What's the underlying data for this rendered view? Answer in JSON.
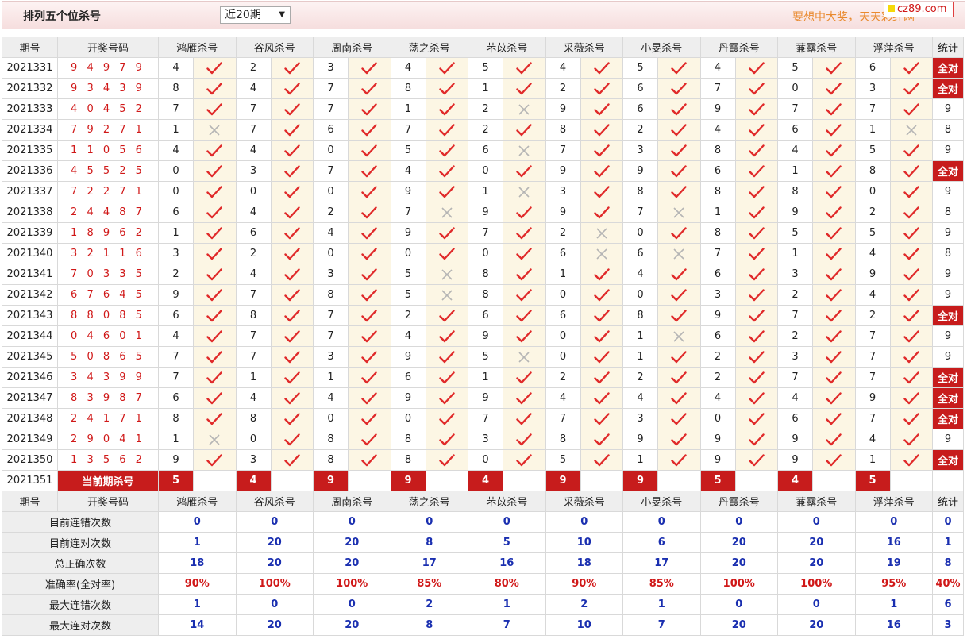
{
  "header": {
    "title": "排列五个位杀号",
    "range_select": "近20期",
    "marquee": "要想中大奖，天天彩经网",
    "logo": "cz89.com"
  },
  "columns": {
    "period": "期号",
    "draw": "开奖号码",
    "experts": [
      "鸿雁杀号",
      "谷风杀号",
      "周南杀号",
      "荡之杀号",
      "芣苡杀号",
      "采薇杀号",
      "小旻杀号",
      "丹霞杀号",
      "蒹露杀号",
      "浮萍杀号"
    ],
    "total": "统计"
  },
  "rows": [
    {
      "period": "2021331",
      "draw": "9 4 9 7 9",
      "kills": [
        4,
        2,
        3,
        4,
        5,
        4,
        5,
        4,
        5,
        6
      ],
      "hits": [
        1,
        1,
        1,
        1,
        1,
        1,
        1,
        1,
        1,
        1
      ],
      "total": "全对"
    },
    {
      "period": "2021332",
      "draw": "9 3 4 3 9",
      "kills": [
        8,
        4,
        7,
        8,
        1,
        2,
        6,
        7,
        0,
        3
      ],
      "hits": [
        1,
        1,
        1,
        1,
        1,
        1,
        1,
        1,
        1,
        1
      ],
      "total": "全对"
    },
    {
      "period": "2021333",
      "draw": "4 0 4 5 2",
      "kills": [
        7,
        7,
        7,
        1,
        2,
        9,
        6,
        9,
        7,
        7
      ],
      "hits": [
        1,
        1,
        1,
        1,
        0,
        1,
        1,
        1,
        1,
        1
      ],
      "total": "9"
    },
    {
      "period": "2021334",
      "draw": "7 9 2 7 1",
      "kills": [
        1,
        7,
        6,
        7,
        2,
        8,
        2,
        4,
        6,
        1
      ],
      "hits": [
        0,
        1,
        1,
        1,
        1,
        1,
        1,
        1,
        1,
        0
      ],
      "total": "8"
    },
    {
      "period": "2021335",
      "draw": "1 1 0 5 6",
      "kills": [
        4,
        4,
        0,
        5,
        6,
        7,
        3,
        8,
        4,
        5
      ],
      "hits": [
        1,
        1,
        1,
        1,
        0,
        1,
        1,
        1,
        1,
        1
      ],
      "total": "9"
    },
    {
      "period": "2021336",
      "draw": "4 5 5 2 5",
      "kills": [
        0,
        3,
        7,
        4,
        0,
        9,
        9,
        6,
        1,
        8
      ],
      "hits": [
        1,
        1,
        1,
        1,
        1,
        1,
        1,
        1,
        1,
        1
      ],
      "total": "全对"
    },
    {
      "period": "2021337",
      "draw": "7 2 2 7 1",
      "kills": [
        0,
        0,
        0,
        9,
        1,
        3,
        8,
        8,
        8,
        0
      ],
      "hits": [
        1,
        1,
        1,
        1,
        0,
        1,
        1,
        1,
        1,
        1
      ],
      "total": "9"
    },
    {
      "period": "2021338",
      "draw": "2 4 4 8 7",
      "kills": [
        6,
        4,
        2,
        7,
        9,
        9,
        7,
        1,
        9,
        2
      ],
      "hits": [
        1,
        1,
        1,
        0,
        1,
        1,
        0,
        1,
        1,
        1
      ],
      "total": "8"
    },
    {
      "period": "2021339",
      "draw": "1 8 9 6 2",
      "kills": [
        1,
        6,
        4,
        9,
        7,
        2,
        0,
        8,
        5,
        5
      ],
      "hits": [
        1,
        1,
        1,
        1,
        1,
        0,
        1,
        1,
        1,
        1
      ],
      "total": "9"
    },
    {
      "period": "2021340",
      "draw": "3 2 1 1 6",
      "kills": [
        3,
        2,
        0,
        0,
        0,
        6,
        6,
        7,
        1,
        4
      ],
      "hits": [
        1,
        1,
        1,
        1,
        1,
        0,
        0,
        1,
        1,
        1
      ],
      "total": "8"
    },
    {
      "period": "2021341",
      "draw": "7 0 3 3 5",
      "kills": [
        2,
        4,
        3,
        5,
        8,
        1,
        4,
        6,
        3,
        9
      ],
      "hits": [
        1,
        1,
        1,
        0,
        1,
        1,
        1,
        1,
        1,
        1
      ],
      "total": "9"
    },
    {
      "period": "2021342",
      "draw": "6 7 6 4 5",
      "kills": [
        9,
        7,
        8,
        5,
        8,
        0,
        0,
        3,
        2,
        4
      ],
      "hits": [
        1,
        1,
        1,
        0,
        1,
        1,
        1,
        1,
        1,
        1
      ],
      "total": "9"
    },
    {
      "period": "2021343",
      "draw": "8 8 0 8 5",
      "kills": [
        6,
        8,
        7,
        2,
        6,
        6,
        8,
        9,
        7,
        2
      ],
      "hits": [
        1,
        1,
        1,
        1,
        1,
        1,
        1,
        1,
        1,
        1
      ],
      "total": "全对"
    },
    {
      "period": "2021344",
      "draw": "0 4 6 0 1",
      "kills": [
        4,
        7,
        7,
        4,
        9,
        0,
        1,
        6,
        2,
        7
      ],
      "hits": [
        1,
        1,
        1,
        1,
        1,
        1,
        0,
        1,
        1,
        1
      ],
      "total": "9"
    },
    {
      "period": "2021345",
      "draw": "5 0 8 6 5",
      "kills": [
        7,
        7,
        3,
        9,
        5,
        0,
        1,
        2,
        3,
        7
      ],
      "hits": [
        1,
        1,
        1,
        1,
        0,
        1,
        1,
        1,
        1,
        1
      ],
      "total": "9"
    },
    {
      "period": "2021346",
      "draw": "3 4 3 9 9",
      "kills": [
        7,
        1,
        1,
        6,
        1,
        2,
        2,
        2,
        7,
        7
      ],
      "hits": [
        1,
        1,
        1,
        1,
        1,
        1,
        1,
        1,
        1,
        1
      ],
      "total": "全对"
    },
    {
      "period": "2021347",
      "draw": "8 3 9 8 7",
      "kills": [
        6,
        4,
        4,
        9,
        9,
        4,
        4,
        4,
        4,
        9
      ],
      "hits": [
        1,
        1,
        1,
        1,
        1,
        1,
        1,
        1,
        1,
        1
      ],
      "total": "全对"
    },
    {
      "period": "2021348",
      "draw": "2 4 1 7 1",
      "kills": [
        8,
        8,
        0,
        0,
        7,
        7,
        3,
        0,
        6,
        7
      ],
      "hits": [
        1,
        1,
        1,
        1,
        1,
        1,
        1,
        1,
        1,
        1
      ],
      "total": "全对"
    },
    {
      "period": "2021349",
      "draw": "2 9 0 4 1",
      "kills": [
        1,
        0,
        8,
        8,
        3,
        8,
        9,
        9,
        9,
        4
      ],
      "hits": [
        0,
        1,
        1,
        1,
        1,
        1,
        1,
        1,
        1,
        1
      ],
      "total": "9"
    },
    {
      "period": "2021350",
      "draw": "1 3 5 6 2",
      "kills": [
        9,
        3,
        8,
        8,
        0,
        5,
        1,
        9,
        9,
        1
      ],
      "hits": [
        1,
        1,
        1,
        1,
        1,
        1,
        1,
        1,
        1,
        1
      ],
      "total": "全对"
    }
  ],
  "current": {
    "period": "2021351",
    "label": "当前期杀号",
    "kills": [
      5,
      4,
      9,
      9,
      4,
      9,
      9,
      5,
      4,
      5
    ]
  },
  "stats": [
    {
      "label": "目前连错次数",
      "values": [
        "0",
        "0",
        "0",
        "0",
        "0",
        "0",
        "0",
        "0",
        "0",
        "0"
      ],
      "total": "0"
    },
    {
      "label": "目前连对次数",
      "values": [
        "1",
        "20",
        "20",
        "8",
        "5",
        "10",
        "6",
        "20",
        "20",
        "16"
      ],
      "total": "1"
    },
    {
      "label": "总正确次数",
      "values": [
        "18",
        "20",
        "20",
        "17",
        "16",
        "18",
        "17",
        "20",
        "20",
        "19"
      ],
      "total": "8"
    },
    {
      "label": "准确率(全对率)",
      "values": [
        "90%",
        "100%",
        "100%",
        "85%",
        "80%",
        "90%",
        "85%",
        "100%",
        "100%",
        "95%"
      ],
      "total": "40%",
      "rate": true
    },
    {
      "label": "最大连错次数",
      "values": [
        "1",
        "0",
        "0",
        "2",
        "1",
        "2",
        "1",
        "0",
        "0",
        "1"
      ],
      "total": "6"
    },
    {
      "label": "最大连对次数",
      "values": [
        "14",
        "20",
        "20",
        "8",
        "7",
        "10",
        "7",
        "20",
        "20",
        "16"
      ],
      "total": "3"
    }
  ],
  "colors": {
    "accent": "#c71c1c",
    "check": "#e02a2a",
    "cross": "#b5b5b5",
    "stat_blue": "#1a2fb0",
    "mark_bg": "#fcf6e4"
  }
}
